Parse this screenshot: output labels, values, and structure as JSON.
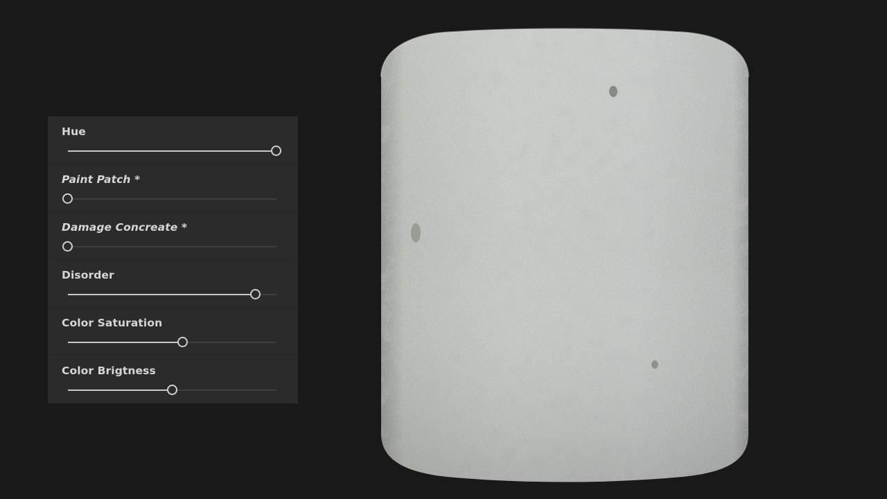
{
  "parameters": [
    {
      "label": "Hue",
      "italic": false,
      "value": 1.0
    },
    {
      "label": "Paint Patch *",
      "italic": true,
      "value": 0.0
    },
    {
      "label": "Damage Concreate *",
      "italic": true,
      "value": 0.0
    },
    {
      "label": "Disorder",
      "italic": false,
      "value": 0.9
    },
    {
      "label": "Color Saturation",
      "italic": false,
      "value": 0.55
    },
    {
      "label": "Color Brigtness",
      "italic": false,
      "value": 0.5
    }
  ],
  "preview": {
    "object": "concrete-cylinder",
    "colors": {
      "surface": "#c4c8c4",
      "shadow": "#8e938f",
      "highlight": "#e0e1dc"
    }
  }
}
